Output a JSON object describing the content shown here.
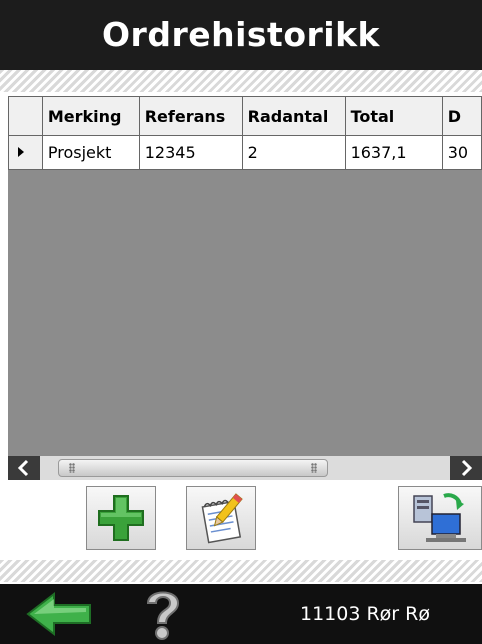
{
  "header": {
    "title": "Ordrehistorikk"
  },
  "table": {
    "columns": [
      "Merking",
      "Referans",
      "Radantal",
      "Total",
      "D"
    ],
    "rows": [
      {
        "cells": [
          "Prosjekt",
          "12345",
          "2",
          "1637,1",
          "30"
        ]
      }
    ]
  },
  "toolbar": {
    "buttons": [
      {
        "icon": "plus-icon"
      },
      {
        "icon": "notepad-pencil-icon"
      },
      {
        "icon": "network-sync-icon"
      }
    ]
  },
  "footer": {
    "back_icon": "back-arrow-icon",
    "help_icon": "question-mark-icon",
    "store_label": "11103 Rør Rø"
  },
  "colors": {
    "header_bg": "#1c1c1c",
    "grid_bg": "#8c8c8c",
    "accent_green": "#3aa23a"
  }
}
